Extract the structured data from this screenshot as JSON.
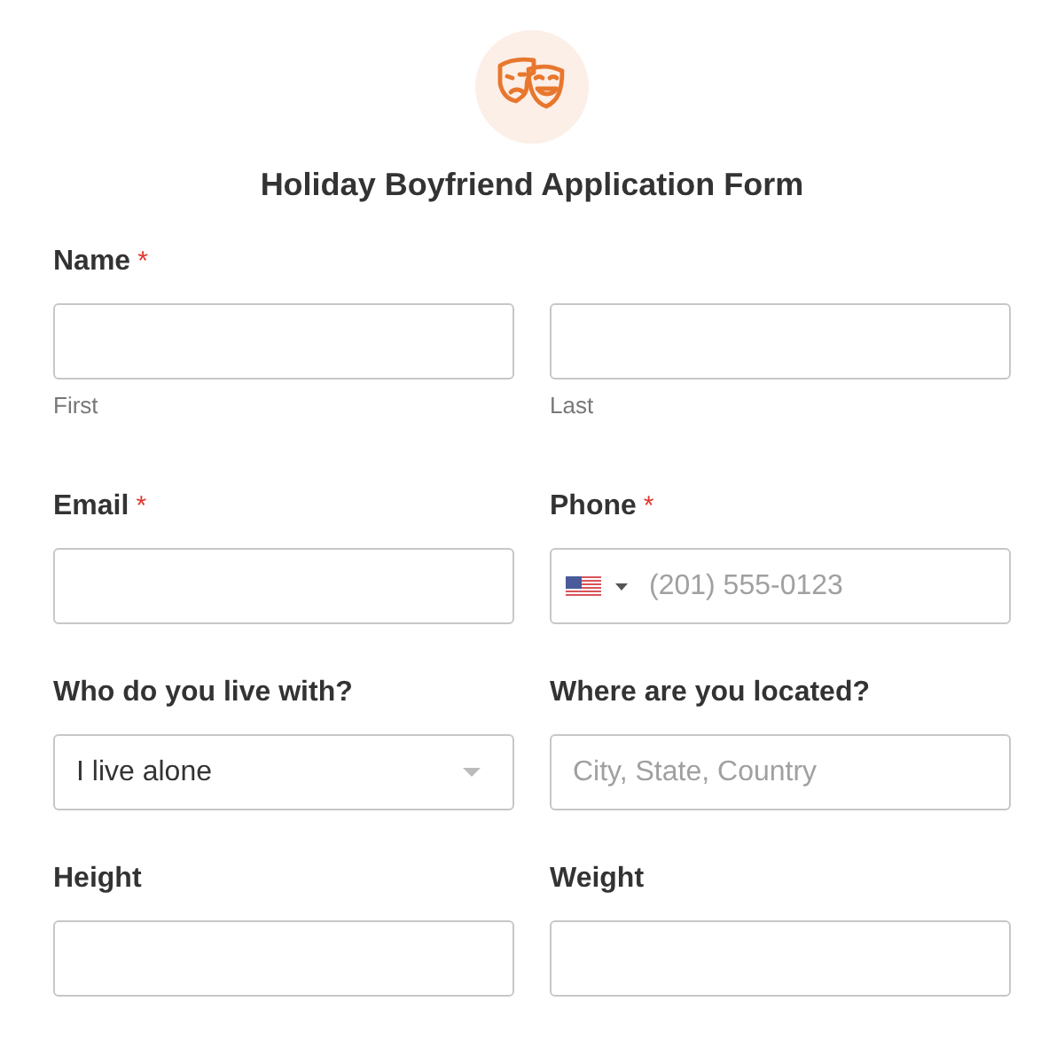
{
  "form": {
    "title": "Holiday Boyfriend Application Form"
  },
  "fields": [
    {
      "kind": "name",
      "label": "Name",
      "required_mark": "*",
      "parts": [
        {
          "sublabel": "First"
        },
        {
          "sublabel": "Last"
        }
      ]
    },
    {
      "kind": "text",
      "label": "Email",
      "required_mark": "*"
    },
    {
      "kind": "phone",
      "label": "Phone",
      "required_mark": "*",
      "placeholder": "(201) 555-0123"
    },
    {
      "kind": "select",
      "label": "Who do you live with?",
      "value": "I live alone"
    },
    {
      "kind": "text",
      "label": "Where are you located?",
      "placeholder": "City, State, Country"
    },
    {
      "kind": "text",
      "label": "Height"
    },
    {
      "kind": "text",
      "label": "Weight"
    }
  ]
}
